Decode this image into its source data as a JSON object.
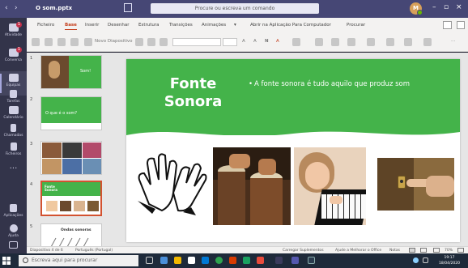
{
  "window": {
    "filename": "O som.pptx",
    "search_placeholder": "Procure ou escreva um comando",
    "avatar_initials": "M"
  },
  "rail": {
    "items": [
      {
        "label": "Atividade",
        "badge": "1"
      },
      {
        "label": "Conversa",
        "badge": "1"
      },
      {
        "label": "Equipas",
        "badge": ""
      },
      {
        "label": "Tarefas",
        "badge": ""
      },
      {
        "label": "Calendário",
        "badge": ""
      },
      {
        "label": "Chamadas",
        "badge": ""
      },
      {
        "label": "Ficheiros",
        "badge": ""
      }
    ],
    "apps_label": "Aplicações",
    "help_label": "Ajuda"
  },
  "ribbon": {
    "tabs": [
      "Ficheiro",
      "Base",
      "Inserir",
      "Desenhar",
      "Estrutura",
      "Transições",
      "Animações"
    ],
    "active_tab": "Base",
    "open_desktop": "Abrir na Aplicação Para Computador",
    "search": "Procurar",
    "new_slide": "Novo Diapositivo"
  },
  "thumbs": [
    {
      "num": "1",
      "title": "Som!"
    },
    {
      "num": "2",
      "title": "O que é o som?"
    },
    {
      "num": "3",
      "title": ""
    },
    {
      "num": "4",
      "title": "Fonte Sonora"
    },
    {
      "num": "5",
      "title": "Ondas sonoras"
    }
  ],
  "slide": {
    "title": "Fonte Sonora",
    "bullet": "A fonte sonora é tudo aquilo que produz som",
    "images": [
      "clapping-hands",
      "drums",
      "piano",
      "doorbell"
    ]
  },
  "statusbar": {
    "slide_info": "Diapositivo 4 de 6",
    "language": "Português (Portugal)",
    "addins": "Carregar Suplementos",
    "feedback": "Ajude a Melhorar o Office",
    "notes": "Notas",
    "zoom": "70%"
  },
  "taskbar": {
    "search_placeholder": "Escreva aqui para procurar",
    "time": "19:17",
    "date": "18/04/2020"
  },
  "colors": {
    "teams_purple": "#464775",
    "rail": "#33344a",
    "slide_green": "#44b34a",
    "accent": "#c43e1c"
  }
}
